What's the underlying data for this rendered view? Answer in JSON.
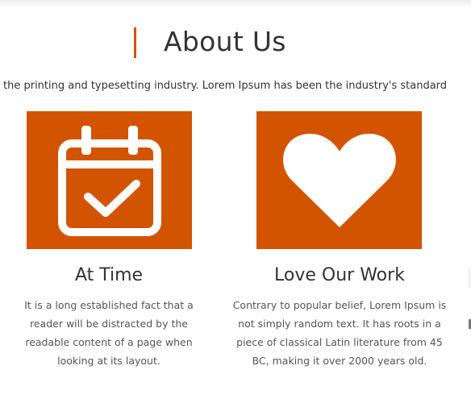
{
  "section": {
    "title": "About Us",
    "accent_color": "#d35400",
    "intro": "the printing and typesetting industry. Lorem Ipsum has been the industry's standard"
  },
  "features": [
    {
      "icon": "calendar-check-icon",
      "title": "At Time",
      "text": "It is a long established fact that a reader will be distracted by the readable content of a page when looking at its layout."
    },
    {
      "icon": "heart-icon",
      "title": "Love Our Work",
      "text": "Contrary to popular belief, Lorem Ipsum is not simply random text. It has roots in a piece of classical Latin literature from 45 BC, making it over 2000 years old."
    }
  ]
}
